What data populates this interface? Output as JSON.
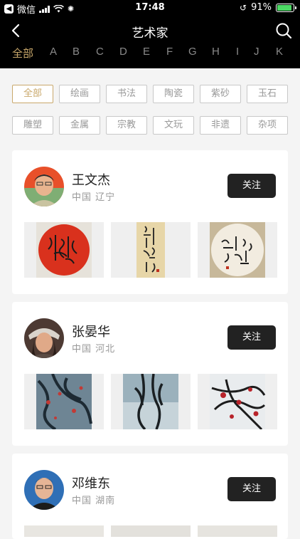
{
  "status": {
    "carrier": "微信",
    "time": "17:48",
    "battery": "91%"
  },
  "nav": {
    "title": "艺术家",
    "letters": [
      "全部",
      "A",
      "B",
      "C",
      "D",
      "E",
      "F",
      "G",
      "H",
      "I",
      "J",
      "K"
    ]
  },
  "filters": [
    "全部",
    "绘画",
    "书法",
    "陶瓷",
    "紫砂",
    "玉石",
    "雕塑",
    "金属",
    "宗教",
    "文玩",
    "非遗",
    "杂项"
  ],
  "follow_label": "关注",
  "artists": [
    {
      "name": "王文杰",
      "location": "中国 辽宁"
    },
    {
      "name": "张晏华",
      "location": "中国 河北"
    },
    {
      "name": "邓维东",
      "location": "中国 湖南"
    }
  ],
  "colors": {
    "accent": "#c9a86b",
    "nav_bg": "#000000",
    "button_bg": "#222222"
  },
  "icons": [
    "back-chevron-icon",
    "search-icon",
    "wifi-icon",
    "battery-icon"
  ]
}
